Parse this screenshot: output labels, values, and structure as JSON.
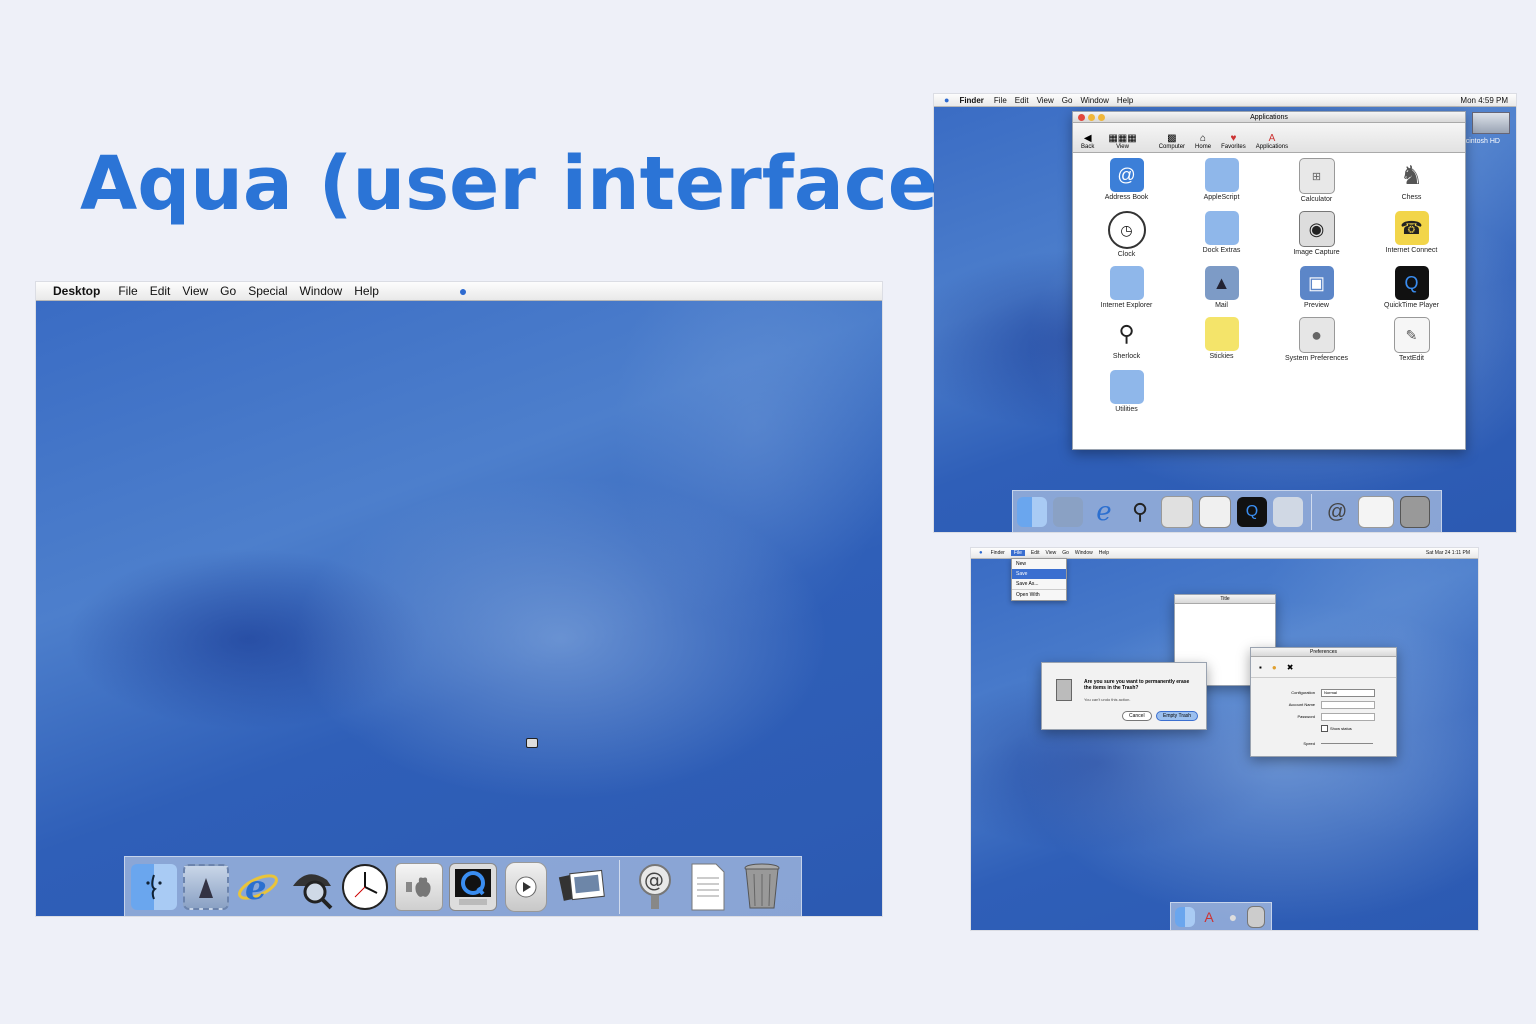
{
  "title": "Aqua (user interface)",
  "colors": {
    "accent": "#2b74d6",
    "desktop": "#3a6cc4"
  },
  "main_screenshot": {
    "menubar": {
      "apple_icon": "apple-icon",
      "items": [
        "Desktop",
        "File",
        "Edit",
        "View",
        "Go",
        "Special",
        "Window",
        "Help"
      ]
    },
    "dock": {
      "icons": [
        "finder-icon",
        "mail-icon",
        "internet-explorer-icon",
        "sherlock-icon",
        "clock-icon",
        "system-preferences-icon",
        "quicktime-icon",
        "itunes-icon",
        "image-capture-icon",
        "at-sign-icon",
        "document-icon",
        "trash-icon"
      ]
    }
  },
  "finder_screenshot": {
    "menubar": {
      "items": [
        "Finder",
        "File",
        "Edit",
        "View",
        "Go",
        "Window",
        "Help"
      ],
      "clock": "Mon 4:59 PM"
    },
    "window": {
      "title": "Applications",
      "toolbar": [
        "Back",
        "View",
        "Computer",
        "Home",
        "Favorites",
        "Applications"
      ],
      "apps": [
        "Address Book",
        "AppleScript",
        "Calculator",
        "Chess",
        "Clock",
        "Dock Extras",
        "Image Capture",
        "Internet Connect",
        "Internet Explorer",
        "Mail",
        "Preview",
        "QuickTime Player",
        "Sherlock",
        "Stickies",
        "System Preferences",
        "TextEdit",
        "Utilities"
      ]
    },
    "desktop_label": "Macintosh HD"
  },
  "dialog_screenshot": {
    "menubar": {
      "items": [
        "Finder",
        "File",
        "Edit",
        "View",
        "Go",
        "Window",
        "Help"
      ],
      "clock": "Sat Mar 24  1:11 PM"
    },
    "file_menu": [
      "New",
      "Save",
      "Save As...",
      "Open With"
    ],
    "alert": {
      "message": "Are you sure you want to permanently erase the items in the Trash?",
      "sub": "You can't undo this action.",
      "cancel": "Cancel",
      "ok": "Empty Trash"
    },
    "prefs": {
      "title": "Preferences",
      "field_labels": [
        "Configuration",
        "Account Name",
        "Password",
        "Speed"
      ],
      "config_value": "Normal",
      "checkbox": "Show status"
    },
    "blank_window_title": "Title"
  }
}
